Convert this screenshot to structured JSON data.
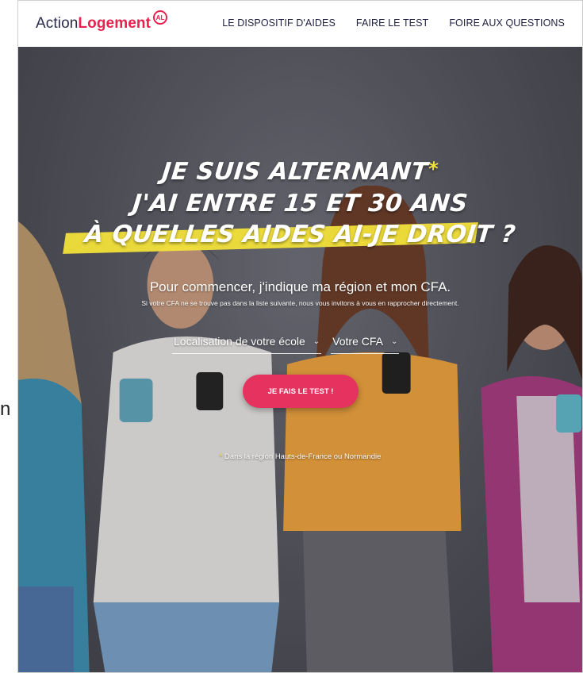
{
  "stray_text": "n",
  "header": {
    "logo": {
      "part1": "Action",
      "part2": "Logement",
      "badge": "AL"
    },
    "nav": [
      {
        "label": "LE DISPOSITIF D'AIDES"
      },
      {
        "label": "FAIRE LE TEST"
      },
      {
        "label": "FOIRE AUX QUESTIONS"
      }
    ]
  },
  "hero": {
    "line1": "JE SUIS ALTERNANT",
    "star": "*",
    "line2": "J'AI ENTRE 15 ET 30 ANS",
    "line3_prefix": "À",
    "line3_highlight": "QUELLES AIDES AI-JE DROIT",
    "line3_suffix": "?",
    "intro": "Pour commencer, j'indique ma région et mon CFA.",
    "note": "Si votre CFA ne se trouve pas dans la liste suivante, nous vous invitons à vous en rapprocher directement.",
    "select_location": "Localisation de votre école",
    "select_cfa": "Votre CFA",
    "cta": "JE FAIS LE TEST !",
    "footnote_star": "*",
    "footnote": "Dans la région Hauts-de-France ou Normandie"
  },
  "colors": {
    "brand_red": "#e6224e",
    "brand_navy": "#2b2b4e",
    "cta": "#e6325f",
    "highlight": "#f2e03a"
  }
}
